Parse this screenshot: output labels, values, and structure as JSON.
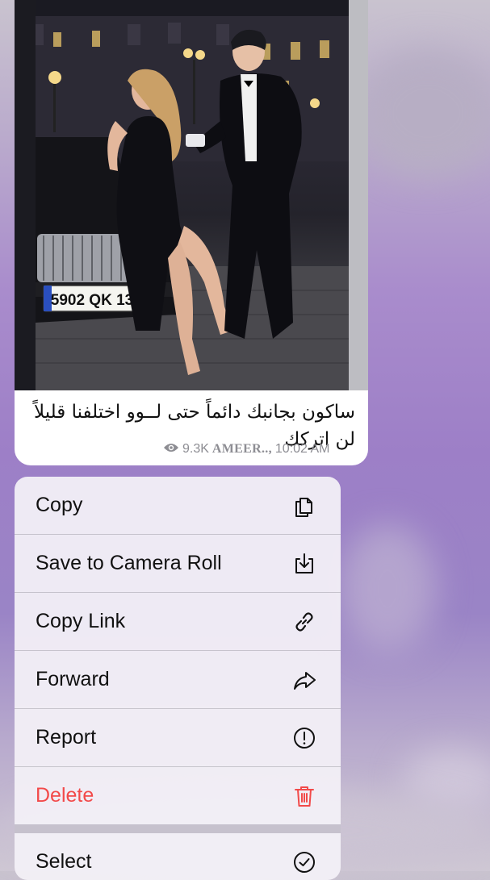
{
  "message": {
    "caption": "ساكون بجانبك دائماً حتى لــوو اختلفنا قليلاً لن اتركك",
    "views": "9.3K",
    "author": "AMEER..,",
    "time": "10:02 AM",
    "photo": {
      "license_plate": "5902 QK 13"
    }
  },
  "menu": {
    "items": [
      {
        "label": "Copy",
        "icon": "copy-icon"
      },
      {
        "label": "Save to Camera Roll",
        "icon": "save-download-icon"
      },
      {
        "label": "Copy Link",
        "icon": "link-icon"
      },
      {
        "label": "Forward",
        "icon": "forward-arrow-icon"
      },
      {
        "label": "Report",
        "icon": "report-exclamation-icon"
      },
      {
        "label": "Delete",
        "icon": "trash-icon",
        "color": "#f24a4a"
      },
      {
        "label": "Select",
        "icon": "checkmark-circle-icon"
      }
    ]
  },
  "colors": {
    "danger": "#f24a4a",
    "meta_gray": "#8d8d93"
  }
}
